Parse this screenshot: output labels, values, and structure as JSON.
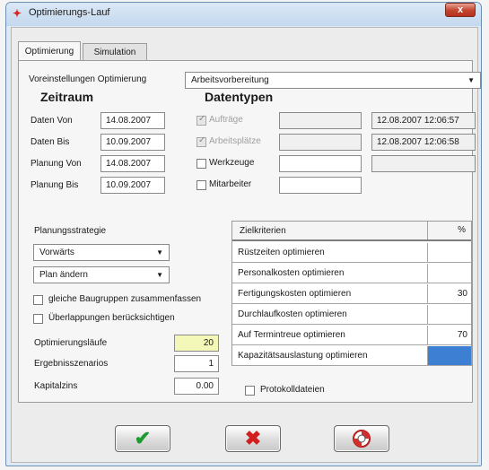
{
  "window": {
    "title": "Optimierungs-Lauf",
    "close_label": "x"
  },
  "tabs": [
    {
      "label": "Optimierung"
    },
    {
      "label": "Simulation"
    }
  ],
  "presets": {
    "label": "Voreinstellungen Optimierung",
    "value": "Arbeitsvorbereitung"
  },
  "zeitraum": {
    "header": "Zeitraum",
    "rows": [
      {
        "label": "Daten Von",
        "value": "14.08.2007"
      },
      {
        "label": "Daten Bis",
        "value": "10.09.2007"
      },
      {
        "label": "Planung Von",
        "value": "14.08.2007"
      },
      {
        "label": "Planung Bis",
        "value": "10.09.2007"
      }
    ]
  },
  "datentypen": {
    "header": "Datentypen",
    "rows": [
      {
        "label": "Aufträge",
        "checked": true,
        "enabled": false,
        "timestamp": "12.08.2007 12:06:57"
      },
      {
        "label": "Arbeitsplätze",
        "checked": true,
        "enabled": false,
        "timestamp": "12.08.2007 12:06:58"
      },
      {
        "label": "Werkzeuge",
        "checked": false,
        "enabled": true,
        "timestamp": ""
      },
      {
        "label": "Mitarbeiter",
        "checked": false,
        "enabled": true,
        "timestamp": ""
      }
    ]
  },
  "strategy": {
    "label": "Planungsstrategie",
    "direction": "Vorwärts",
    "plan_mode": "Plan ändern",
    "option1": "gleiche Baugruppen zusammenfassen",
    "option2": "Überlappungen berücksichtigen",
    "runs_label": "Optimierungsläufe",
    "runs_value": "20",
    "scenarios_label": "Ergebnisszenarios",
    "scenarios_value": "1",
    "interest_label": "Kapitalzins",
    "interest_value": "0.00"
  },
  "criteria": {
    "header_name": "Zielkriterien",
    "header_pct": "%",
    "rows": [
      {
        "name": "Rüstzeiten optimieren",
        "value": ""
      },
      {
        "name": "Personalkosten optimieren",
        "value": ""
      },
      {
        "name": "Fertigungskosten optimieren",
        "value": "30"
      },
      {
        "name": "Durchlaufkosten optimieren",
        "value": ""
      },
      {
        "name": "Auf Termintreue optimieren",
        "value": "70"
      },
      {
        "name": "Kapazitätsauslastung optimieren",
        "value": ""
      }
    ]
  },
  "protocol": {
    "label": "Protokolldateien"
  },
  "colors": {
    "accent_cell": "#3d7fd2",
    "runs_field": "#f3f7b8"
  }
}
